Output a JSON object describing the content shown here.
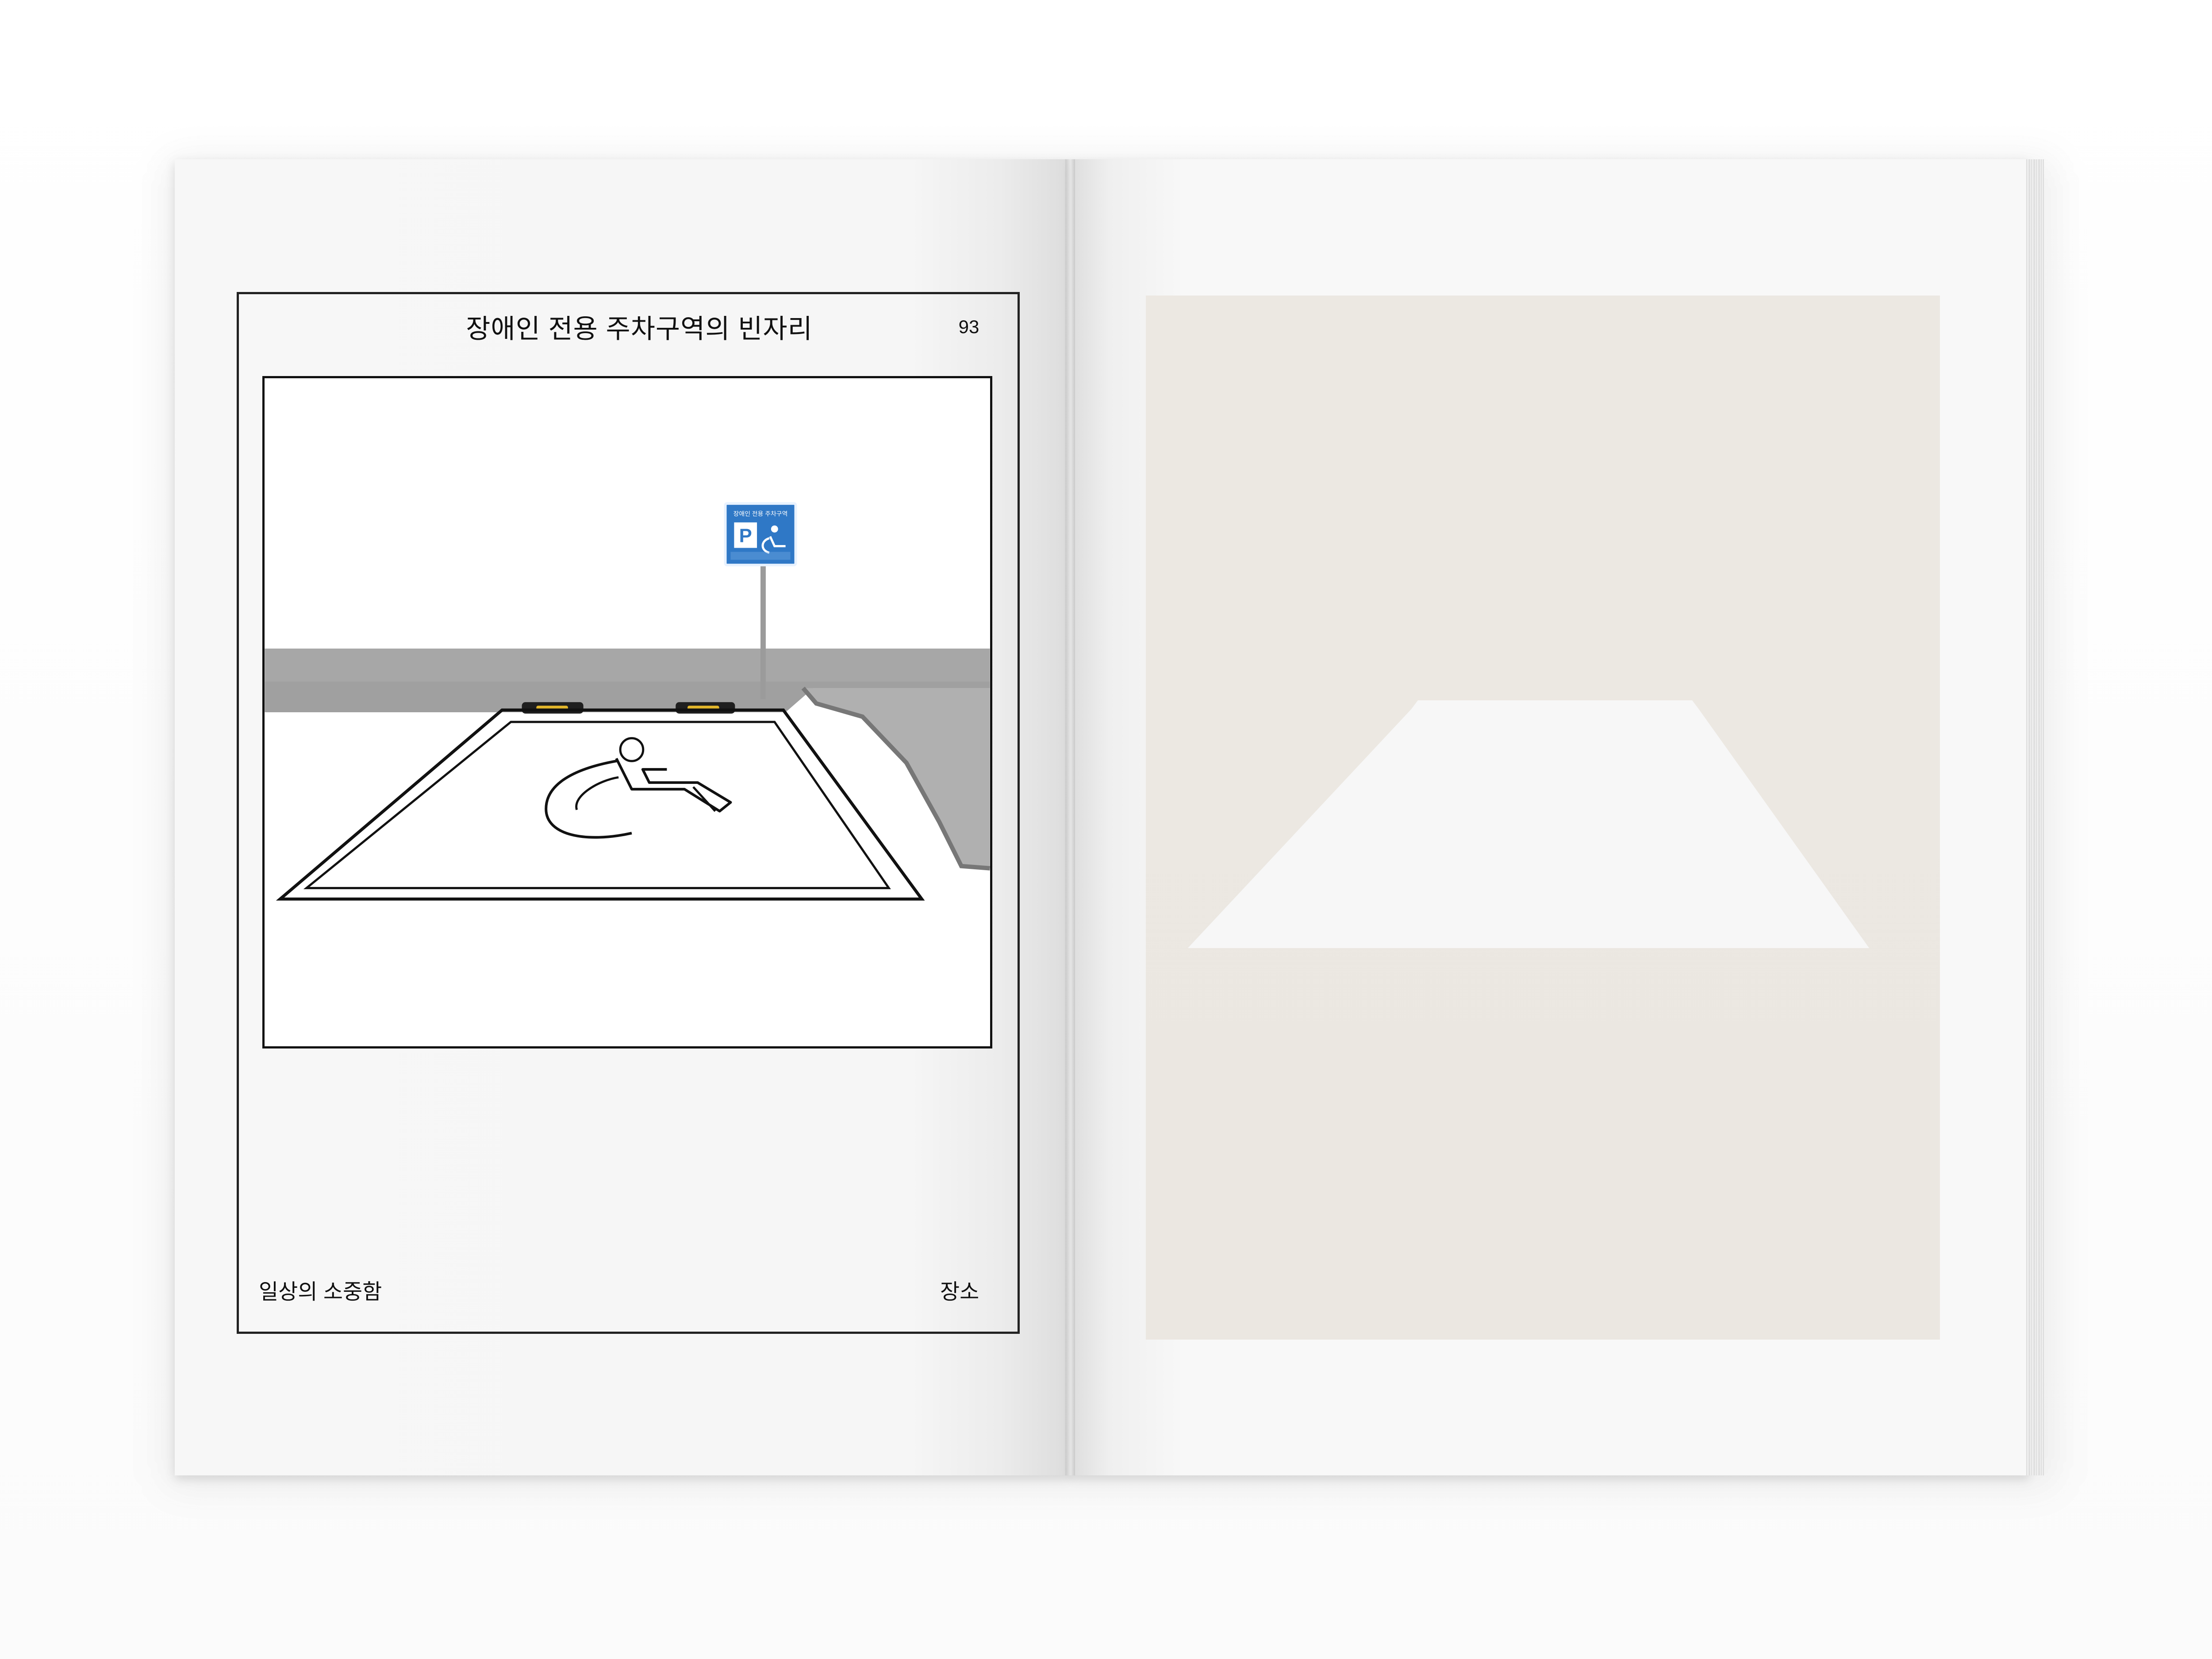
{
  "left_page": {
    "title": "장애인 전용 주차구역의 빈자리",
    "page_number": "93",
    "footer_left": "일상의 소중함",
    "footer_right": "장소"
  },
  "photo": {
    "sign_title": "장애인 전용 주차구역",
    "sign_letter": "P"
  },
  "colors": {
    "page": "#f7f7f7",
    "frame": "#222222",
    "panel": "#ece8e2",
    "sign_blue": "#2f78c6",
    "curb": "#8d8d8d"
  }
}
